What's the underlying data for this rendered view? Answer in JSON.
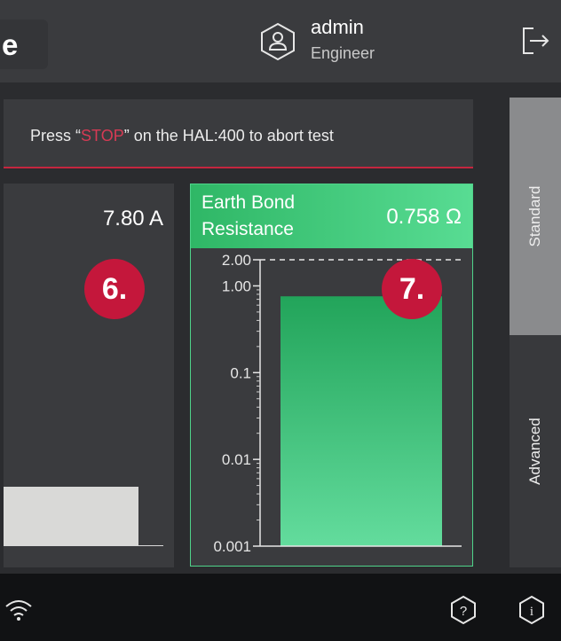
{
  "header": {
    "app_title_fragment": "e",
    "user_name": "admin",
    "user_role": "Engineer"
  },
  "banner": {
    "prefix": "Press “",
    "stop": "STOP",
    "suffix": "” on the HAL:400 to abort test"
  },
  "tabs": [
    {
      "label": "Standard",
      "active": true
    },
    {
      "label": "Advanced",
      "active": false
    }
  ],
  "left_card": {
    "value": "7.80 A",
    "badge": "6."
  },
  "right_card": {
    "label_line1": "Earth Bond",
    "label_line2": "Resistance",
    "value": "0.758 Ω",
    "badge": "7."
  },
  "chart_data": {
    "type": "bar",
    "scale": "log",
    "ylim": [
      0.001,
      2.0
    ],
    "tick_labels": [
      "2.00",
      "1.00",
      "0.1",
      "0.01",
      "0.001"
    ],
    "tick_values": [
      2.0,
      1.0,
      0.1,
      0.01,
      0.001
    ],
    "limit_line": 2.0,
    "values": [
      0.758
    ],
    "bar_color": "#2fb766"
  },
  "footer": {
    "icons": [
      "wifi-icon",
      "help-icon",
      "info-icon"
    ]
  },
  "colors": {
    "accent_red": "#c4173b",
    "accent_green": "#2fb766",
    "stop_text": "#d63a54"
  }
}
